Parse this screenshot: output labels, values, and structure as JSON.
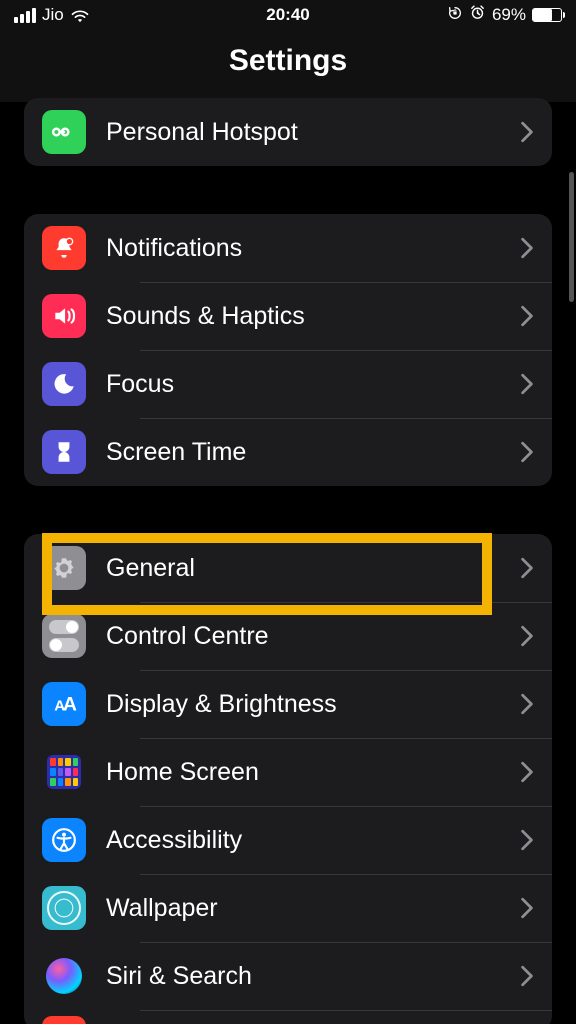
{
  "status": {
    "carrier": "Jio",
    "time": "20:40",
    "battery_pct": "69%"
  },
  "header": {
    "title": "Settings"
  },
  "groups": {
    "g1": {
      "hotspot": "Personal Hotspot"
    },
    "g2": {
      "notifications": "Notifications",
      "sounds": "Sounds & Haptics",
      "focus": "Focus",
      "screentime": "Screen Time"
    },
    "g3": {
      "general": "General",
      "control": "Control Centre",
      "display": "Display & Brightness",
      "home": "Home Screen",
      "access": "Accessibility",
      "wallpaper": "Wallpaper",
      "siri": "Siri & Search"
    }
  }
}
